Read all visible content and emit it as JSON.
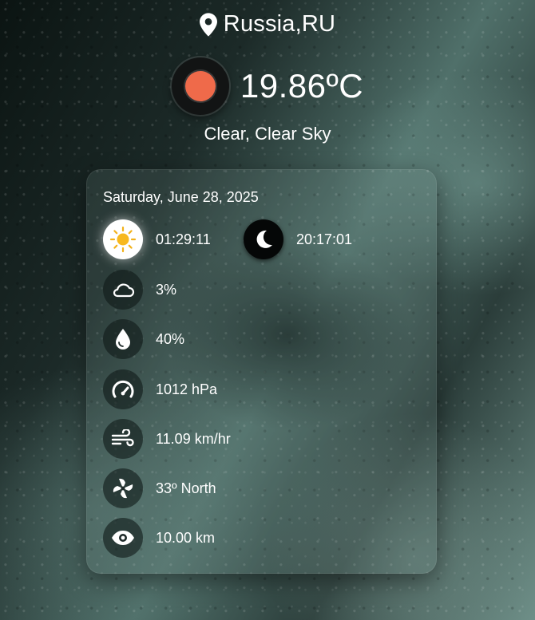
{
  "location": {
    "city": "Russia,RU",
    "icon": "map-pin-icon"
  },
  "current": {
    "temperature": "19.86ºC",
    "description": "Clear, Clear Sky",
    "icon": "clear-sky-icon",
    "icon_color": "#ef6a4a"
  },
  "card": {
    "date": "Saturday, June 28, 2025",
    "sunrise": {
      "icon": "sun-icon",
      "value": "01:29:11"
    },
    "sunset": {
      "icon": "moon-icon",
      "value": "20:17:01"
    },
    "clouds": {
      "icon": "cloud-icon",
      "value": "3%"
    },
    "humidity": {
      "icon": "water-drop-icon",
      "value": "40%"
    },
    "pressure": {
      "icon": "gauge-icon",
      "value": "1012 hPa"
    },
    "wind_speed": {
      "icon": "wind-icon",
      "value": "11.09 km/hr"
    },
    "wind_direction": {
      "icon": "fan-icon",
      "value": "33º North"
    },
    "visibility": {
      "icon": "eye-icon",
      "value": "10.00 km"
    }
  }
}
